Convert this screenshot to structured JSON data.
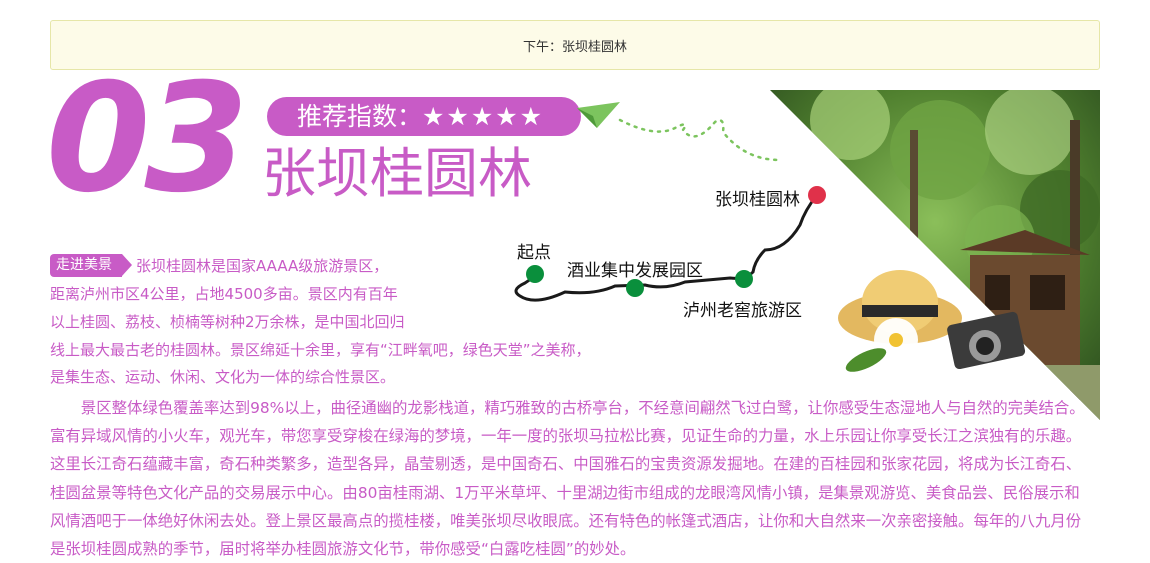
{
  "banner": {
    "text": "下午：张坝桂圆林"
  },
  "section_number": "03",
  "rating": {
    "label": "推荐指数：",
    "stars": "★★★★★",
    "value": 5
  },
  "title": "张坝桂圆林",
  "map": {
    "start_label": "起点",
    "stop1_label": "酒业集中发展园区",
    "stop2_label": "泸州老窖旅游区",
    "destination_label": "张坝桂圆林"
  },
  "badge": "走进美景",
  "intro_lines": [
    "张坝桂圆林是国家AAAA级旅游景区，",
    "距离泸州市区4公里，占地4500多亩。景区内有百年",
    "以上桂圆、荔枝、桢楠等树种2万余株，是中国北回归",
    "线上最大最古老的桂圆林。景区绵延十余里，享有“江畔氧吧，绿色天堂”之美称，",
    "是集生态、运动、休闲、文化为一体的综合性景区。"
  ],
  "paragraph": "景区整体绿色覆盖率达到98%以上，曲径通幽的龙影栈道，精巧雅致的古桥亭台，不经意间翩然飞过白鹭，让你感受生态湿地人与自然的完美结合。富有异域风情的小火车，观光车，带您享受穿梭在绿海的梦境，一年一度的张坝马拉松比赛，见证生命的力量，水上乐园让你享受长江之滨独有的乐趣。这里长江奇石蕴藏丰富，奇石种类繁多，造型各异，晶莹剔透，是中国奇石、中国雅石的宝贵资源发掘地。在建的百桂园和张家花园，将成为长江奇石、桂圆盆景等特色文化产品的交易展示中心。由80亩桂雨湖、1万平米草坪、十里湖边街市组成的龙眼湾风情小镇，是集景观游览、美食品尝、民俗展示和风情酒吧于一体绝好休闲去处。登上景区最高点的揽桂楼，唯美张坝尽收眼底。还有特色的帐篷式酒店，让你和大自然来一次亲密接触。每年的八九月份是张坝桂圆成熟的季节，届时将举办桂圆旅游文化节，带你感受“白露吃桂圆”的妙处。",
  "colors": {
    "accent": "#c85bc6",
    "banner_bg": "#fdfbe8",
    "map_dot": "#0a8f3c",
    "destination_dot": "#e0314a"
  }
}
